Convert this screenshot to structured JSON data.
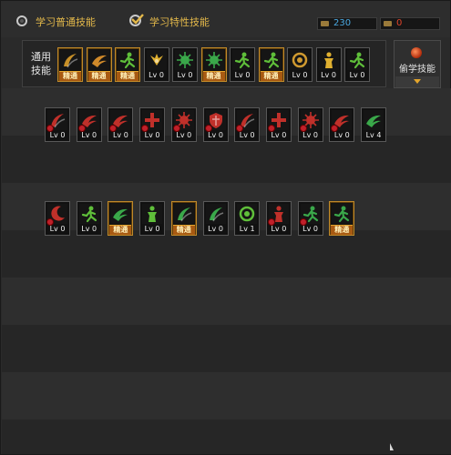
{
  "tabs": {
    "normal": "学习普通技能",
    "special": "学习特性技能"
  },
  "currency": {
    "sp": {
      "value": "230",
      "color": "#4aa8e0"
    },
    "tp": {
      "value": "0",
      "color": "#e0442a"
    }
  },
  "general": {
    "label": "通用技能",
    "skills": [
      {
        "lv": "精通",
        "mastered": true,
        "hue": "#c89028",
        "glyph": "swoosh"
      },
      {
        "lv": "精通",
        "mastered": true,
        "hue": "#d08a2a",
        "glyph": "wave"
      },
      {
        "lv": "精通",
        "mastered": true,
        "hue": "#5fbf3a",
        "glyph": "runner"
      },
      {
        "lv": "Lv 0",
        "mastered": false,
        "hue": "#e0b030",
        "glyph": "wings"
      },
      {
        "lv": "Lv 0",
        "mastered": false,
        "hue": "#3aa84a",
        "glyph": "burst"
      },
      {
        "lv": "精通",
        "mastered": true,
        "hue": "#3aa84a",
        "glyph": "burst"
      },
      {
        "lv": "Lv 0",
        "mastered": false,
        "hue": "#5fbf3a",
        "glyph": "runner"
      },
      {
        "lv": "精通",
        "mastered": true,
        "hue": "#5fbf3a",
        "glyph": "runner"
      },
      {
        "lv": "Lv 0",
        "mastered": false,
        "hue": "#d09a30",
        "glyph": "ring"
      },
      {
        "lv": "Lv 0",
        "mastered": false,
        "hue": "#e0b030",
        "glyph": "figure"
      },
      {
        "lv": "Lv 0",
        "mastered": false,
        "hue": "#5fbf3a",
        "glyph": "runner"
      }
    ]
  },
  "steal": {
    "label": "偷学技能"
  },
  "row2": [
    {
      "lv": "Lv 0",
      "mastered": false,
      "hue": "#c0302a",
      "glyph": "swoosh",
      "gem": true
    },
    {
      "lv": "Lv 0",
      "mastered": false,
      "hue": "#c0302a",
      "glyph": "wave",
      "gem": true
    },
    {
      "lv": "Lv 0",
      "mastered": false,
      "hue": "#c0302a",
      "glyph": "wave",
      "gem": true
    },
    {
      "lv": "Lv 0",
      "mastered": false,
      "hue": "#c0302a",
      "glyph": "cross",
      "gem": true
    },
    {
      "lv": "Lv 0",
      "mastered": false,
      "hue": "#c0302a",
      "glyph": "burst",
      "gem": true
    },
    {
      "lv": "Lv 0",
      "mastered": false,
      "hue": "#c0302a",
      "glyph": "shield",
      "gem": true
    },
    {
      "lv": "Lv 0",
      "mastered": false,
      "hue": "#c0302a",
      "glyph": "swoosh",
      "gem": true
    },
    {
      "lv": "Lv 0",
      "mastered": false,
      "hue": "#c0302a",
      "glyph": "cross",
      "gem": true
    },
    {
      "lv": "Lv 0",
      "mastered": false,
      "hue": "#c0302a",
      "glyph": "burst",
      "gem": true
    },
    {
      "lv": "Lv 0",
      "mastered": false,
      "hue": "#c0302a",
      "glyph": "wave",
      "gem": true
    },
    {
      "lv": "Lv 4",
      "mastered": false,
      "hue": "#3aa84a",
      "glyph": "wave",
      "gem": false
    }
  ],
  "row3": [
    {
      "lv": "Lv 0",
      "mastered": false,
      "hue": "#c0302a",
      "glyph": "moon",
      "gem": true
    },
    {
      "lv": "Lv 0",
      "mastered": false,
      "hue": "#5fbf3a",
      "glyph": "runner",
      "gem": false
    },
    {
      "lv": "精通",
      "mastered": true,
      "hue": "#3aa84a",
      "glyph": "wave",
      "gem": false
    },
    {
      "lv": "Lv 0",
      "mastered": false,
      "hue": "#5fbf3a",
      "glyph": "figure",
      "gem": false
    },
    {
      "lv": "精通",
      "mastered": true,
      "hue": "#3aa84a",
      "glyph": "swoosh",
      "gem": false
    },
    {
      "lv": "Lv 0",
      "mastered": false,
      "hue": "#3aa84a",
      "glyph": "swoosh",
      "gem": false
    },
    {
      "lv": "Lv 1",
      "mastered": false,
      "hue": "#5fbf3a",
      "glyph": "ring",
      "gem": false
    },
    {
      "lv": "Lv 0",
      "mastered": false,
      "hue": "#c0302a",
      "glyph": "figure",
      "gem": true
    },
    {
      "lv": "Lv 0",
      "mastered": false,
      "hue": "#3aa84a",
      "glyph": "runner",
      "gem": true
    },
    {
      "lv": "精通",
      "mastered": true,
      "hue": "#3aa84a",
      "glyph": "runner",
      "gem": false
    }
  ]
}
